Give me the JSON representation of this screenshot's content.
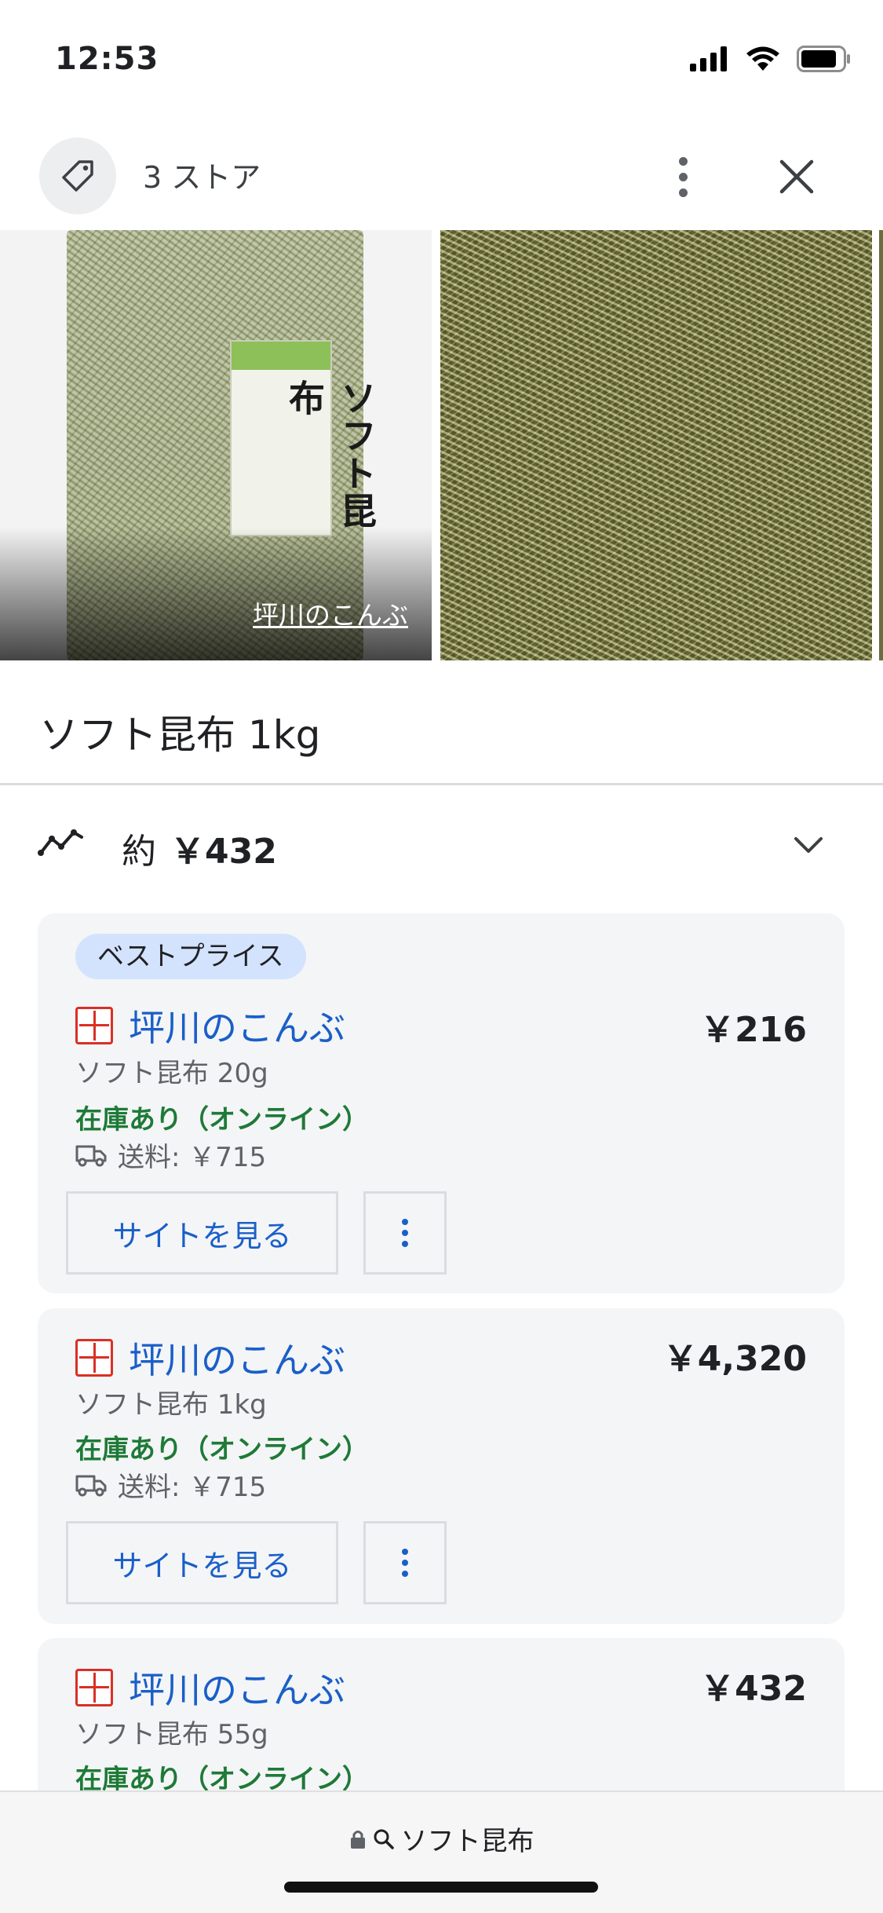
{
  "status_bar": {
    "time": "12:53"
  },
  "header": {
    "title": "3 ストア"
  },
  "images": {
    "source_label": "坪川のこんぶ"
  },
  "product": {
    "title": "ソフト昆布 1kg"
  },
  "price_summary": {
    "prefix": "約",
    "value": "￥432"
  },
  "offers": [
    {
      "badge": "ベストプライス",
      "store": "坪川のこんぶ",
      "price": "￥216",
      "description": "ソフト昆布 20g",
      "stock": "在庫あり（オンライン）",
      "shipping": "送料: ￥715",
      "button": "サイトを見る"
    },
    {
      "store": "坪川のこんぶ",
      "price": "￥4,320",
      "description": "ソフト昆布 1kg",
      "stock": "在庫あり（オンライン）",
      "shipping": "送料: ￥715",
      "button": "サイトを見る"
    },
    {
      "store": "坪川のこんぶ",
      "price": "￥432",
      "description": "ソフト昆布 55g",
      "stock": "在庫あり（オンライン）"
    }
  ],
  "bottom_bar": {
    "url_text": "ソフト昆布"
  },
  "icons": {
    "tag": "tag-icon",
    "more": "more-vert-icon",
    "close": "close-icon",
    "trend": "price-trend-icon",
    "expand": "chevron-down-icon",
    "truck": "truck-icon",
    "lock": "lock-icon",
    "search": "search-icon"
  },
  "colors": {
    "link_blue": "#1a5fc8",
    "stock_green": "#1e7a37",
    "badge_bg": "#d3e3fd",
    "card_bg": "#f4f5f7"
  }
}
